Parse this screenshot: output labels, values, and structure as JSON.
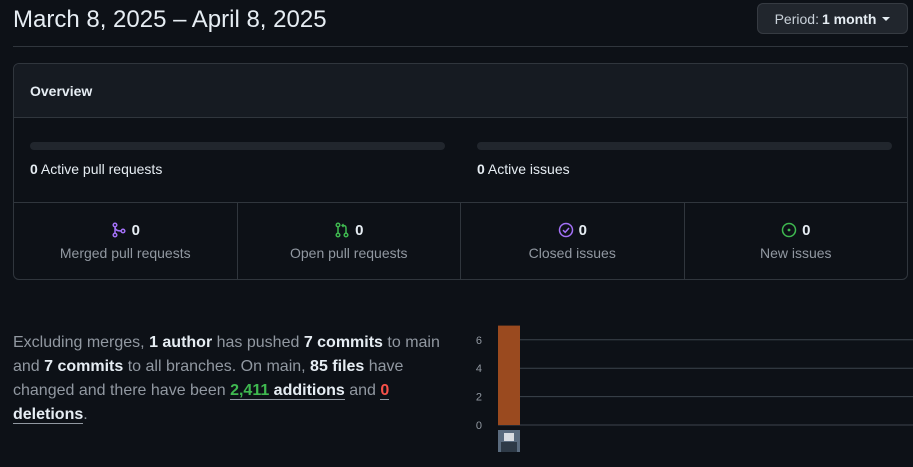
{
  "header": {
    "title": "March 8, 2025 – April 8, 2025",
    "period_label": "Period:",
    "period_value": "1 month"
  },
  "overview": {
    "title": "Overview",
    "active_pull_requests": {
      "count": "0",
      "label": "Active pull requests"
    },
    "active_issues": {
      "count": "0",
      "label": "Active issues"
    },
    "stats": [
      {
        "icon": "merged-pr-icon",
        "count": "0",
        "label": "Merged pull requests",
        "color": "#a371f7"
      },
      {
        "icon": "open-pr-icon",
        "count": "0",
        "label": "Open pull requests",
        "color": "#3fb950"
      },
      {
        "icon": "closed-issue-icon",
        "count": "0",
        "label": "Closed issues",
        "color": "#a371f7"
      },
      {
        "icon": "new-issue-icon",
        "count": "0",
        "label": "New issues",
        "color": "#3fb950"
      }
    ]
  },
  "summary": {
    "t1": "Excluding merges, ",
    "authors": "1 author",
    "t2": " has pushed ",
    "commits_main": "7 commits",
    "t3": " to main and ",
    "commits_all": "7 commits",
    "t4": " to all branches. On main, ",
    "files": "85 files",
    "t5": " have changed and there have been ",
    "additions_num": "2,411",
    "additions_word": " additions",
    "t6": " and ",
    "deletions_num": "0",
    "deletions_word": " deletions",
    "t7": "."
  },
  "chart_data": {
    "type": "bar",
    "categories": [
      ""
    ],
    "values": [
      7
    ],
    "ylim": [
      0,
      7
    ],
    "yticks": [
      "0",
      "2",
      "4",
      "6"
    ],
    "bar_color": "#9a4a1f",
    "grid": true
  }
}
